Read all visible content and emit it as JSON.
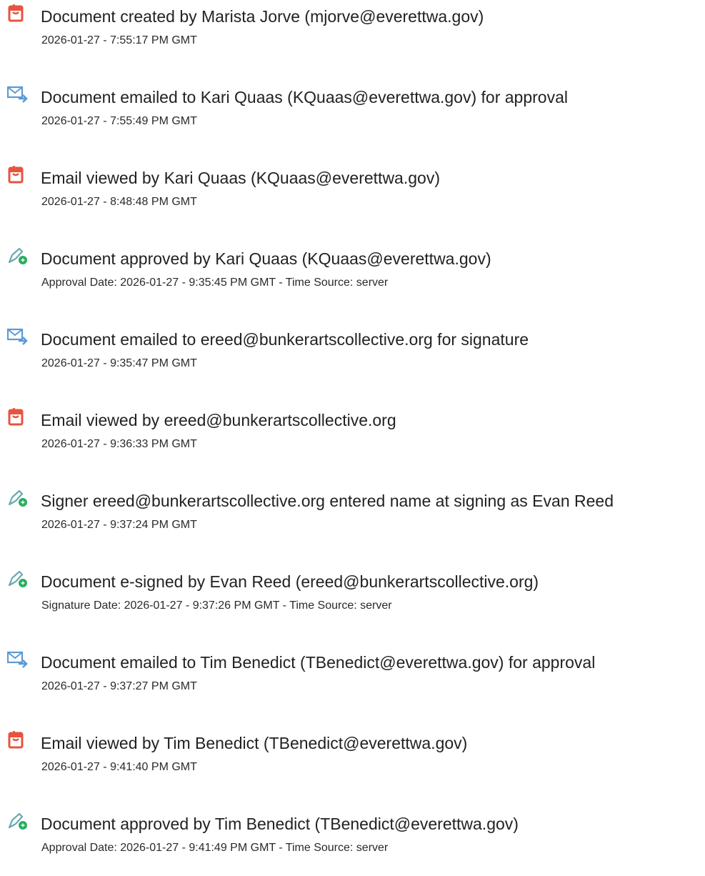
{
  "entries": [
    {
      "icon": "document-created-icon",
      "title": "Document created by Marista Jorve (mjorve@everettwa.gov)",
      "detail": "2026-01-27 - 7:55:17 PM GMT"
    },
    {
      "icon": "email-sent-icon",
      "title": "Document emailed to Kari Quaas (KQuaas@everettwa.gov) for approval",
      "detail": "2026-01-27 - 7:55:49 PM GMT"
    },
    {
      "icon": "document-viewed-icon",
      "title": "Email viewed by Kari Quaas (KQuaas@everettwa.gov)",
      "detail": "2026-01-27 - 8:48:48 PM GMT"
    },
    {
      "icon": "esign-pen-icon",
      "title": "Document approved by Kari Quaas (KQuaas@everettwa.gov)",
      "detail": "Approval Date: 2026-01-27 - 9:35:45 PM GMT - Time Source: server"
    },
    {
      "icon": "email-sent-icon",
      "title": "Document emailed to ereed@bunkerartscollective.org for signature",
      "detail": "2026-01-27 - 9:35:47 PM GMT"
    },
    {
      "icon": "document-viewed-icon",
      "title": "Email viewed by ereed@bunkerartscollective.org",
      "detail": "2026-01-27 - 9:36:33 PM GMT"
    },
    {
      "icon": "esign-pen-icon",
      "title": "Signer ereed@bunkerartscollective.org entered name at signing as Evan Reed",
      "detail": "2026-01-27 - 9:37:24 PM GMT"
    },
    {
      "icon": "esign-pen-icon",
      "title": "Document e-signed by Evan Reed (ereed@bunkerartscollective.org)",
      "detail": "Signature Date: 2026-01-27 - 9:37:26 PM GMT - Time Source: server"
    },
    {
      "icon": "email-sent-icon",
      "title": "Document emailed to Tim Benedict (TBenedict@everettwa.gov) for approval",
      "detail": "2026-01-27 - 9:37:27 PM GMT"
    },
    {
      "icon": "document-viewed-icon",
      "title": "Email viewed by Tim Benedict (TBenedict@everettwa.gov)",
      "detail": "2026-01-27 - 9:41:40 PM GMT"
    },
    {
      "icon": "esign-pen-icon",
      "title": "Document approved by Tim Benedict (TBenedict@everettwa.gov)",
      "detail": "Approval Date: 2026-01-27 - 9:41:49 PM GMT - Time Source: server"
    }
  ],
  "colors": {
    "document_icon": "#e8533f",
    "email_icon": "#5b9bd5",
    "pen_icon": "#6aaab1",
    "badge": "#27ae60"
  }
}
